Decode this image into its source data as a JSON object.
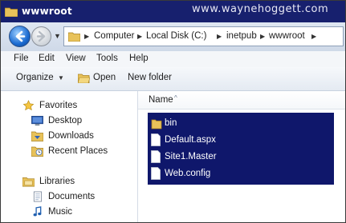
{
  "window": {
    "title": "wwwroot",
    "watermark": "www.waynehoggett.com"
  },
  "address": {
    "crumbs": [
      "Computer",
      "Local Disk (C:)",
      "inetpub",
      "wwwroot"
    ]
  },
  "menu": {
    "items": [
      "File",
      "Edit",
      "View",
      "Tools",
      "Help"
    ]
  },
  "commands": {
    "organize": "Organize",
    "open": "Open",
    "new_folder": "New folder"
  },
  "nav": {
    "favorites_header": "Favorites",
    "favorites": [
      "Desktop",
      "Downloads",
      "Recent Places"
    ],
    "libraries_header": "Libraries",
    "libraries": [
      "Documents",
      "Music"
    ]
  },
  "content": {
    "column_name": "Name",
    "files": [
      {
        "name": "bin",
        "icon": "folder-icon"
      },
      {
        "name": "Default.aspx",
        "icon": "file-icon"
      },
      {
        "name": "Site1.Master",
        "icon": "file-icon"
      },
      {
        "name": "Web.config",
        "icon": "file-icon"
      }
    ]
  },
  "colors": {
    "titlebar": "#17206e",
    "selection": "#0f176b",
    "folder": "#e8c25a"
  }
}
